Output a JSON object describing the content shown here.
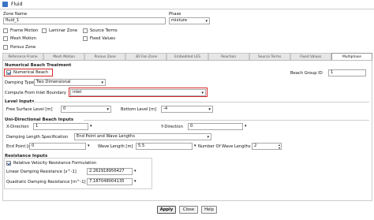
{
  "window": {
    "title": "Fluid"
  },
  "zone_name": {
    "label": "Zone Name",
    "value": "fluid_1"
  },
  "phase": {
    "label": "Phase",
    "value": "mixture"
  },
  "options": [
    {
      "label": "Frame Motion",
      "checked": false
    },
    {
      "label": "Laminar Zone",
      "checked": false
    },
    {
      "label": "Source Terms",
      "checked": false
    },
    {
      "label": "Mesh Motion",
      "checked": false
    },
    {
      "label": "Fixed Values",
      "checked": false
    },
    {
      "label": "Porous Zone",
      "checked": false
    }
  ],
  "tabs": [
    {
      "label": "Reference Frame",
      "active": false
    },
    {
      "label": "Mesh Motion",
      "active": false
    },
    {
      "label": "Porous Zone",
      "active": false
    },
    {
      "label": "3D Fan Zone",
      "active": false
    },
    {
      "label": "Embedded LES",
      "active": false
    },
    {
      "label": "Reaction",
      "active": false
    },
    {
      "label": "Source Terms",
      "active": false
    },
    {
      "label": "Fixed Values",
      "active": false
    },
    {
      "label": "Multiphase",
      "active": true
    }
  ],
  "beach": {
    "section_title": "Numerical Beach Treatment",
    "numerical_beach_label": "Numerical Beach",
    "numerical_beach_checked": true,
    "group_id_label": "Beach Group ID",
    "group_id_value": "1",
    "damping_type_label": "Damping Type",
    "damping_type_value": "Two Dimensional",
    "compute_from_label": "Compute From Inlet Boundary",
    "compute_from_value": "inlet"
  },
  "level_inputs": {
    "title": "Level Inputs",
    "free_surface_label": "Free Surface Level [m]",
    "free_surface_value": "0",
    "bottom_level_label": "Bottom Level [m]",
    "bottom_level_value": "-4"
  },
  "uni_inputs": {
    "title": "Uni-Directional Beach Inputs",
    "x_direction_label": "X-Direction",
    "x_direction_value": "1",
    "y_direction_label": "Y-Direction",
    "y_direction_value": "0",
    "damping_spec_label": "Damping Length Specification",
    "damping_spec_value": "End Point and Wave Lengths",
    "end_point_label": "End Point [m]",
    "end_point_value": "0",
    "wave_length_label": "Wave Length [m]",
    "wave_length_value": "5.5",
    "num_wave_lengths_label": "Number Of Wave Lengths",
    "num_wave_lengths_value": "2"
  },
  "resistance": {
    "title": "Resistance Inputs",
    "relative_label": "Relative Velocity Resistance Formulation",
    "relative_checked": true,
    "linear_label": "Linear Damping Resistance [s^-1]",
    "linear_value": "2.262918956427",
    "quadratic_label": "Quadratic Damping Resistance [m^-1]",
    "quadratic_value": "7.187048004135"
  },
  "buttons": {
    "apply": "Apply",
    "close": "Close",
    "help": "Help"
  },
  "colors": {
    "highlight": "#d42a2a",
    "accent": "#3a74c4"
  }
}
